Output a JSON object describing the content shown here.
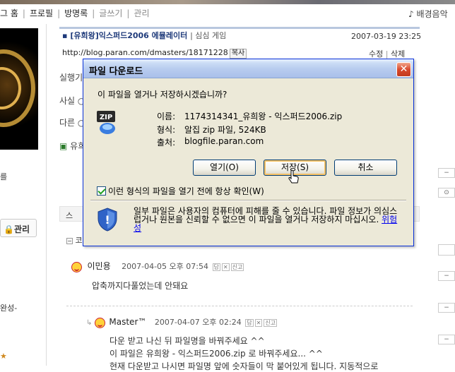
{
  "top_nav": {
    "items": [
      "그 홈",
      "프로필",
      "방명록",
      "글쓰기",
      "관리"
    ],
    "bgm_label": "♪ 배경음악"
  },
  "left_sidebar": {
    "manage_label": "관리",
    "text_1": "실행",
    "text_2": "사시",
    "text_3": "다른",
    "text_4": "유",
    "text_5": "완성-"
  },
  "post": {
    "title": "[유희왕]익스퍼드2006 에뮬레이터",
    "category": "| 심심 게임",
    "date": "2007-03-19 23:25",
    "url": "http://blog.paran.com/dmasters/18171228",
    "copy_label": "복사",
    "edit_label": "수정",
    "delete_label": "삭제",
    "partial_lines": [
      "실행기",
      "사실 ○",
      "다른 ○",
      "유희"
    ]
  },
  "comments": {
    "bar_label_1": "스",
    "bar_label_2": "코",
    "items": [
      {
        "name": "이민용",
        "date": "2007-04-05 오후 07:54",
        "text": "압축까지다풀었는데 안돼요"
      },
      {
        "name": "Master™",
        "date": "2007-04-07 오후 02:24",
        "lines": [
          "다운 받고 나신 뒤 파일명을 바꿔주세요 ^^",
          "이 파일은 유희왕 - 익스퍼드2006.zip 로 바꿔주세요... ^^",
          "현재 다운받고 나시면 파일명 앞에 숫자들이 막 붙어있게 됩니다. 지동적으로"
        ]
      }
    ],
    "tiny_labels": [
      "답",
      "신고"
    ]
  },
  "dialog": {
    "title": "파일 다운로드",
    "question": "이 파일을 열거나 저장하시겠습니까?",
    "name_label": "이름:",
    "name_value": "1174314341_유희왕 - 익스퍼드2006.zip",
    "type_label": "형식:",
    "type_value": "알집 zip 파일, 524KB",
    "from_label": "출처:",
    "from_value": "blogfile.paran.com",
    "open_label": "열기(O)",
    "save_label": "저장(S)",
    "cancel_label": "취소",
    "checkbox_label": "이런 형식의 파일을 열기 전에 항상 확인(W)",
    "checkbox_checked": true,
    "warning": "일부 파일은 사용자의 컴퓨터에 피해를 줄 수 있습니다. 파일 정보가 의심스럽거나 원본을 신뢰할 수 없으면 이 파일을 열거나 저장하지 마십시오.",
    "warning_link": "위험성",
    "close_glyph": "✕",
    "zip_icon_text": "ZIP"
  },
  "colors": {
    "titlebar": "#b9cdef",
    "dialog_bg": "#ece9d8",
    "close_red": "#d8492c",
    "link_blue": "#0000ee",
    "post_title": "#1e3a7a"
  }
}
